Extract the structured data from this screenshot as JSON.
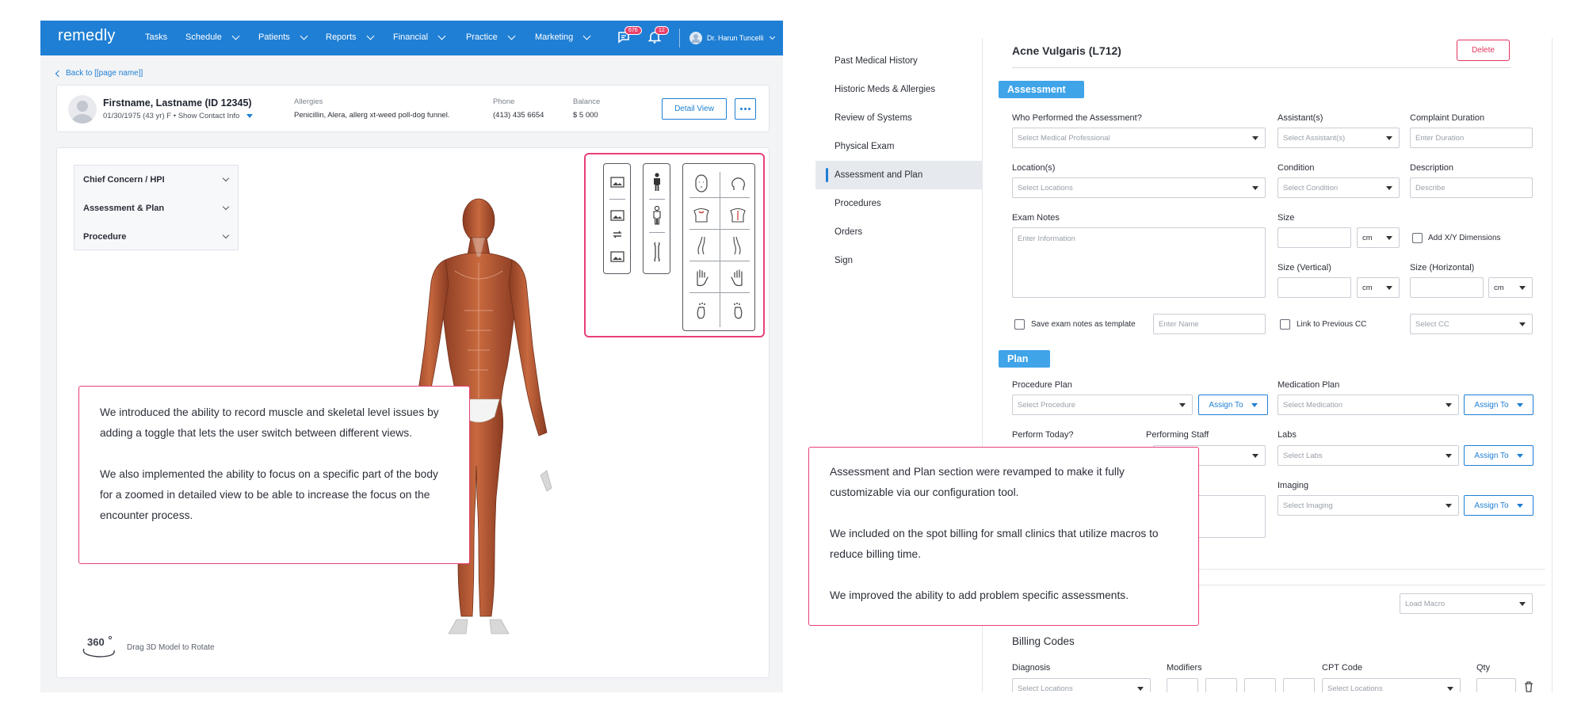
{
  "nav": {
    "logo": "remedly",
    "items": [
      {
        "label": "Tasks",
        "dropdown": false
      },
      {
        "label": "Schedule",
        "dropdown": true
      },
      {
        "label": "Patients",
        "dropdown": true
      },
      {
        "label": "Reports",
        "dropdown": true
      },
      {
        "label": "Financial",
        "dropdown": true
      },
      {
        "label": "Practice",
        "dropdown": true
      },
      {
        "label": "Marketing",
        "dropdown": true
      }
    ],
    "messages_badge": "676",
    "notifications_badge": "12",
    "user_name": "Dr. Harun Tuncelli"
  },
  "back_link": "Back to [[page name]]",
  "patient": {
    "name": "Firstname, Lastname (ID 12345)",
    "dob_line": "01/30/1975 (43 yr) F",
    "contact_link": "Show Contact Info",
    "allergies_label": "Allergies",
    "allergies_value": "Penicillin, Alera, allerg xt-weed poll-dog funnel.",
    "phone_label": "Phone",
    "phone_value": "(413) 435 6654",
    "balance_label": "Balance",
    "balance_value": "$ 5 000",
    "detail_button": "Detail View"
  },
  "accordion": [
    {
      "label": "Chief Concern / HPI"
    },
    {
      "label": "Assessment & Plan"
    },
    {
      "label": "Procedure"
    }
  ],
  "view_icons": {
    "col1": [
      "image-icon",
      "image-icon",
      "swap-icon",
      "image-icon"
    ],
    "col2": [
      "person-front-icon",
      "muscle-figure-icon",
      "bone-icon"
    ],
    "col3": [
      "face-front-icon",
      "head-side-icon",
      "torso-front-icon",
      "torso-back-icon",
      "leg-side-icon",
      "leg-other-side-icon",
      "hand-left-icon",
      "hand-right-icon",
      "foot-left-icon",
      "foot-right-icon"
    ]
  },
  "note_left": {
    "p1": "We introduced the ability to record muscle and skeletal level issues by adding a toggle that lets the user switch between different views.",
    "p2": "We also implemented the ability to focus on a specific part of the body for a zoomed in detailed view to be able to increase the focus on the encounter process."
  },
  "rotate": {
    "badge": "360",
    "label": "Drag 3D Model to Rotate"
  },
  "sidebar": [
    {
      "label": "Past Medical History",
      "active": false
    },
    {
      "label": "Historic Meds & Allergies",
      "active": false
    },
    {
      "label": "Review of Systems",
      "active": false
    },
    {
      "label": "Physical Exam",
      "active": false
    },
    {
      "label": "Assessment and Plan",
      "active": true
    },
    {
      "label": "Procedures",
      "active": false
    },
    {
      "label": "Orders",
      "active": false
    },
    {
      "label": "Sign",
      "active": false
    }
  ],
  "form": {
    "title": "Acne Vulgaris (L712)",
    "delete_button": "Delete",
    "assessment_tag": "Assessment",
    "who_label": "Who Performed the Assessment?",
    "who_placeholder": "Select Medical Professional",
    "assistants_label": "Assistant(s)",
    "assistants_placeholder": "Select Assistant(s)",
    "duration_label": "Complaint Duration",
    "duration_placeholder": "Enter Duration",
    "locations_label": "Location(s)",
    "locations_placeholder": "Select Locations",
    "condition_label": "Condition",
    "condition_placeholder": "Select Condition",
    "description_label": "Description",
    "description_placeholder": "Describe",
    "exam_notes_label": "Exam Notes",
    "exam_notes_placeholder": "Enter Information",
    "size_label": "Size",
    "size_unit": "cm",
    "add_xy_label": "Add X/Y Dimensions",
    "size_vertical_label": "Size (Vertical)",
    "size_vertical_unit": "cm",
    "size_horizontal_label": "Size (Horizontal)",
    "size_horizontal_unit": "cm",
    "save_template_label": "Save exam notes as template",
    "template_name_placeholder": "Enter Name",
    "link_cc_label": "Link to Previous CC",
    "select_cc_placeholder": "Select CC",
    "plan_tag": "Plan",
    "procedure_plan_label": "Procedure Plan",
    "procedure_placeholder": "Select Procedure",
    "assign_to": "Assign To",
    "medication_plan_label": "Medication Plan",
    "medication_placeholder": "Select Medication",
    "perform_today_label": "Perform Today?",
    "performing_staff_label": "Performing Staff",
    "labs_label": "Labs",
    "labs_placeholder": "Select Labs",
    "imaging_label": "Imaging",
    "imaging_placeholder": "Select Imaging",
    "load_macro_placeholder": "Load Macro",
    "billing_title": "Billing Codes",
    "diagnosis_label": "Diagnosis",
    "diagnosis_placeholder": "Select Locations",
    "modifiers_label": "Modifiers",
    "cpt_label": "CPT Code",
    "cpt_placeholder": "Select Locations",
    "qty_label": "Qty"
  },
  "note_right": {
    "p1": "Assessment and Plan section were revamped to make it fully customizable via our configuration tool.",
    "p2": "We included on the spot billing for small clinics that utilize macros to reduce billing time.",
    "p3": "We improved the ability to add problem specific assessments."
  },
  "colors": {
    "brand_blue": "#1f7fd4",
    "section_blue": "#3fa4e8",
    "highlight_pink": "#e8407c",
    "delete_red": "#e1355d",
    "badge_red": "#e8416b",
    "muscle_red": "#b5542f"
  }
}
